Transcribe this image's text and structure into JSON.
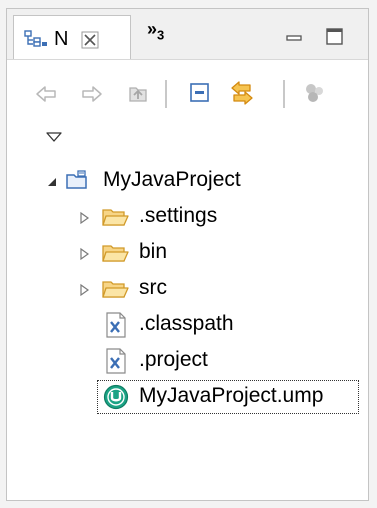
{
  "view": {
    "title_label": "N",
    "close_glyph": "☒",
    "overflow_chevron": "»",
    "overflow_count": "3"
  },
  "toolbar": {
    "buttons": [
      "back-icon",
      "forward-icon",
      "up-icon",
      "collapse-all-icon",
      "link-with-editor-icon",
      "focus-icon"
    ]
  },
  "tree": {
    "project": {
      "label": "MyJavaProject",
      "expanded": true
    },
    "children": [
      {
        "label": ".settings",
        "type": "folder",
        "expandable": true
      },
      {
        "label": "bin",
        "type": "folder",
        "expandable": true
      },
      {
        "label": "src",
        "type": "folder",
        "expandable": true
      },
      {
        "label": ".classpath",
        "type": "xml-file",
        "expandable": false
      },
      {
        "label": ".project",
        "type": "xml-file",
        "expandable": false
      },
      {
        "label": "MyJavaProject.ump",
        "type": "umple-file",
        "expandable": false,
        "selected": true
      }
    ]
  },
  "colors": {
    "folder": "#e8b54a",
    "umple": "#1ba385",
    "disabled": "#b8b8b8",
    "link": "#e39b17",
    "blue": "#3c6fb5"
  }
}
